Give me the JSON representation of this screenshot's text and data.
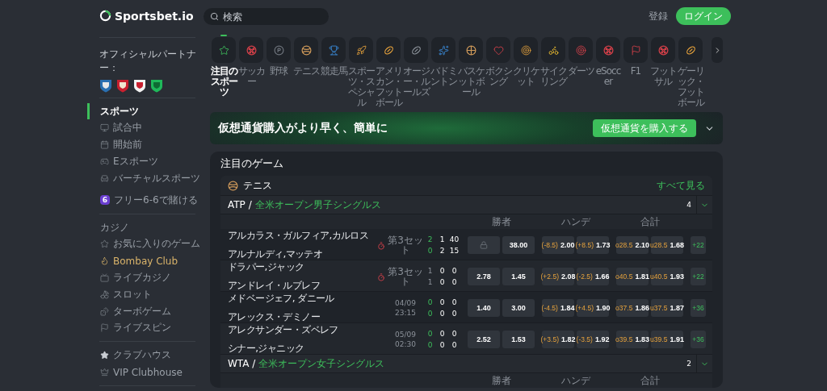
{
  "header": {
    "logo": "Sportsbet.io",
    "search": {
      "placeholder": "検索"
    },
    "register": "登録",
    "login": "ログイン"
  },
  "sidebar": {
    "partner_label": "オフィシャルパートナー：",
    "sports_items": [
      {
        "label": "スポーツ",
        "kind": "sports",
        "selected": true
      },
      {
        "label": "試合中",
        "kind": "live",
        "selected": false
      },
      {
        "label": "開始前",
        "kind": "upcoming",
        "selected": false
      },
      {
        "label": "Eスポーツ",
        "kind": "esports",
        "selected": false
      },
      {
        "label": "バーチャルスポーツ",
        "kind": "virtual",
        "selected": false
      }
    ],
    "promo": {
      "badge": "6",
      "label": "フリー6-6で賭ける"
    },
    "casino_label": "カジノ",
    "casino_items": [
      {
        "label": "お気に入りのゲーム",
        "kind": "favorites",
        "highlight": false
      },
      {
        "label": "Bombay Club",
        "kind": "bombay",
        "highlight": true
      },
      {
        "label": "ライブカジノ",
        "kind": "livecasino",
        "highlight": false
      },
      {
        "label": "スロット",
        "kind": "slots",
        "highlight": false
      },
      {
        "label": "ターボゲーム",
        "kind": "turbo",
        "highlight": false
      },
      {
        "label": "ライブスピン",
        "kind": "livespin",
        "highlight": false
      }
    ],
    "club_items": [
      {
        "label": "クラブハウス",
        "kind": "clubhouse"
      },
      {
        "label": "VIP Clubhouse",
        "kind": "vip"
      }
    ]
  },
  "sports": [
    {
      "label": "注目のスポーツ",
      "kind": "featured",
      "selected": true
    },
    {
      "label": "サッカー",
      "kind": "soccer",
      "selected": false
    },
    {
      "label": "野球",
      "kind": "baseball",
      "selected": false
    },
    {
      "label": "テニス",
      "kind": "tennis",
      "selected": false
    },
    {
      "label": "競走馬",
      "kind": "horse",
      "selected": false
    },
    {
      "label": "スポーツ・スペシャル",
      "kind": "special",
      "selected": false
    },
    {
      "label": "アメリカン・フットボール",
      "kind": "football",
      "selected": false
    },
    {
      "label": "オージー・ルールズ",
      "kind": "aussie",
      "selected": false
    },
    {
      "label": "バドミントン",
      "kind": "badminton",
      "selected": false
    },
    {
      "label": "バスケットボール",
      "kind": "basketball",
      "selected": false
    },
    {
      "label": "ボクシング",
      "kind": "boxing",
      "selected": false
    },
    {
      "label": "クリケット",
      "kind": "cricket",
      "selected": false
    },
    {
      "label": "サイクリング",
      "kind": "cycling",
      "selected": false
    },
    {
      "label": "ダーツ",
      "kind": "darts",
      "selected": false
    },
    {
      "label": "eSoccer",
      "kind": "soccer",
      "selected": false
    },
    {
      "label": "F1",
      "kind": "f1",
      "selected": false
    },
    {
      "label": "フットサル",
      "kind": "soccer",
      "selected": false
    },
    {
      "label": "ゲーリック・フットボール",
      "kind": "football",
      "selected": false
    }
  ],
  "banner": {
    "text": "仮想通貨購入がより早く、簡単に",
    "button": "仮想通貨を購入する"
  },
  "featured": {
    "title": "注目のゲーム",
    "sport": "テニス",
    "see_all": "すべて見る",
    "groups": [
      {
        "tour": "ATP",
        "separator": "/",
        "name": "全米オープン男子シングルス",
        "count": "4",
        "markets": [
          "勝者",
          "ハンデ",
          "合計"
        ],
        "matches": [
          {
            "teams": [
              "アルカラス・ガルフィア,カルロス",
              "アルナルディ,マッテオ"
            ],
            "live": true,
            "status": [
              "第3セット"
            ],
            "sets_highlighted": true,
            "scores": [
              [
                "2",
                "1",
                "40"
              ],
              [
                "0",
                "2",
                "15"
              ]
            ],
            "odds": [
              {
                "locked": true
              },
              {
                "locked": false,
                "value": "38.00"
              },
              {
                "locked": false,
                "line": "(-8.5)",
                "value": "2.00"
              },
              {
                "locked": false,
                "line": "(+8.5)",
                "value": "1.73"
              },
              {
                "locked": false,
                "line": "o28.5",
                "value": "2.10"
              },
              {
                "locked": false,
                "line": "u28.5",
                "value": "1.68"
              }
            ],
            "more": "+22"
          },
          {
            "teams": [
              "ドラパー,ジャック",
              "アンドレイ・ルブレフ"
            ],
            "live": true,
            "status": [
              "第3セット"
            ],
            "sets_highlighted": false,
            "scores": [
              [
                "1",
                "0",
                "0"
              ],
              [
                "1",
                "0",
                "0"
              ]
            ],
            "odds": [
              {
                "locked": false,
                "value": "2.78"
              },
              {
                "locked": false,
                "value": "1.45"
              },
              {
                "locked": false,
                "line": "(+2.5)",
                "value": "2.08"
              },
              {
                "locked": false,
                "line": "(-2.5)",
                "value": "1.66"
              },
              {
                "locked": false,
                "line": "o40.5",
                "value": "1.81"
              },
              {
                "locked": false,
                "line": "u40.5",
                "value": "1.93"
              }
            ],
            "more": "+22"
          },
          {
            "teams": [
              "メドベージェフ, ダニール",
              "アレックス・デミノー"
            ],
            "live": false,
            "status": [
              "04/09",
              "23:15"
            ],
            "sets_highlighted": true,
            "scores": [
              [
                "0",
                "0",
                "0"
              ],
              [
                "0",
                "0",
                "0"
              ]
            ],
            "odds": [
              {
                "locked": false,
                "value": "1.40"
              },
              {
                "locked": false,
                "value": "3.00"
              },
              {
                "locked": false,
                "line": "(-4.5)",
                "value": "1.84"
              },
              {
                "locked": false,
                "line": "(+4.5)",
                "value": "1.90"
              },
              {
                "locked": false,
                "line": "o37.5",
                "value": "1.86"
              },
              {
                "locked": false,
                "line": "u37.5",
                "value": "1.87"
              }
            ],
            "more": "+36"
          },
          {
            "teams": [
              "アレクサンダー・ズベレフ",
              "シナー,ジャニック"
            ],
            "live": false,
            "status": [
              "05/09",
              "02:30"
            ],
            "sets_highlighted": true,
            "scores": [
              [
                "0",
                "0",
                "0"
              ],
              [
                "0",
                "0",
                "0"
              ]
            ],
            "odds": [
              {
                "locked": false,
                "value": "2.52"
              },
              {
                "locked": false,
                "value": "1.53"
              },
              {
                "locked": false,
                "line": "(+3.5)",
                "value": "1.82"
              },
              {
                "locked": false,
                "line": "(-3.5)",
                "value": "1.92"
              },
              {
                "locked": false,
                "line": "o39.5",
                "value": "1.83"
              },
              {
                "locked": false,
                "line": "u39.5",
                "value": "1.91"
              }
            ],
            "more": "+36"
          }
        ]
      },
      {
        "tour": "WTA",
        "separator": "/",
        "name": "全米オープン女子シングルス",
        "count": "2",
        "markets": [
          "勝者",
          "ハンデ",
          "合計"
        ]
      }
    ]
  }
}
